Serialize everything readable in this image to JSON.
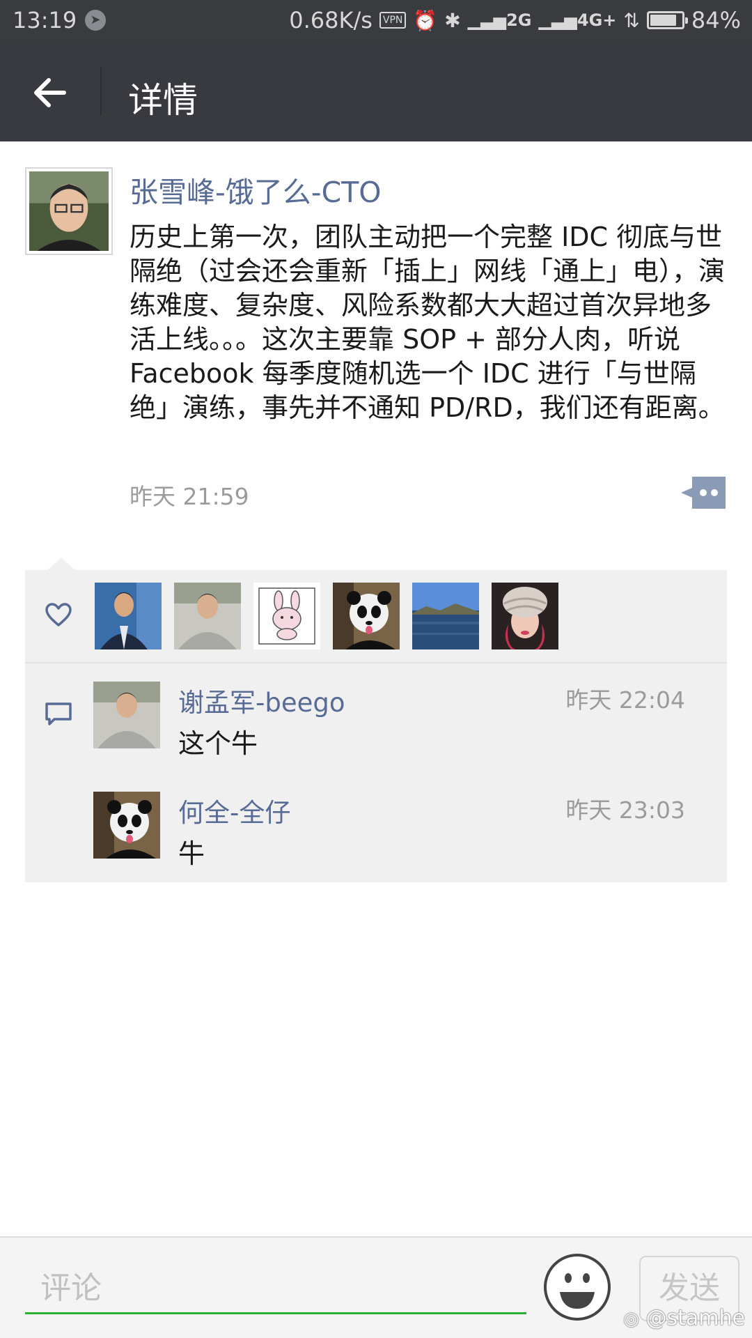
{
  "status_bar": {
    "time": "13:19",
    "speed": "0.68K/s",
    "vpn": "VPN",
    "network_2g": "2G",
    "network_4g": "4G+",
    "battery_text": "84%",
    "battery_level": 0.84
  },
  "header": {
    "title": "详情"
  },
  "post": {
    "author": "张雪峰-饿了么-CTO",
    "text": "历史上第一次，团队主动把一个完整 IDC 彻底与世隔绝（过会还会重新「插上」网线「通上」电），演练难度、复杂度、风险系数都大大超过首次异地多活上线。。。这次主要靠 SOP + 部分人肉，听说 Facebook 每季度随机选一个 IDC 进行「与世隔绝」演练，事先并不通知 PD/RD，我们还有距离。",
    "time": "昨天 21:59"
  },
  "likes": {
    "avatars": [
      "man-in-suit",
      "man-in-gray-hoodie",
      "cartoon-rabbit",
      "panda",
      "lake-landscape",
      "woman-in-fur-hat"
    ]
  },
  "comments": [
    {
      "author": "谢孟军-beego",
      "time": "昨天 22:04",
      "text": "这个牛",
      "avatar": "man-in-gray-hoodie"
    },
    {
      "author": "何全-全仔",
      "time": "昨天 23:03",
      "text": "牛",
      "avatar": "panda"
    }
  ],
  "input_bar": {
    "placeholder": "评论",
    "send_label": "发送"
  },
  "watermark": "@stamhe",
  "colors": {
    "header_bg": "#393a3f",
    "link_blue": "#576b95",
    "panel_bg": "#f0f0f0",
    "input_underline": "#2ab134"
  }
}
